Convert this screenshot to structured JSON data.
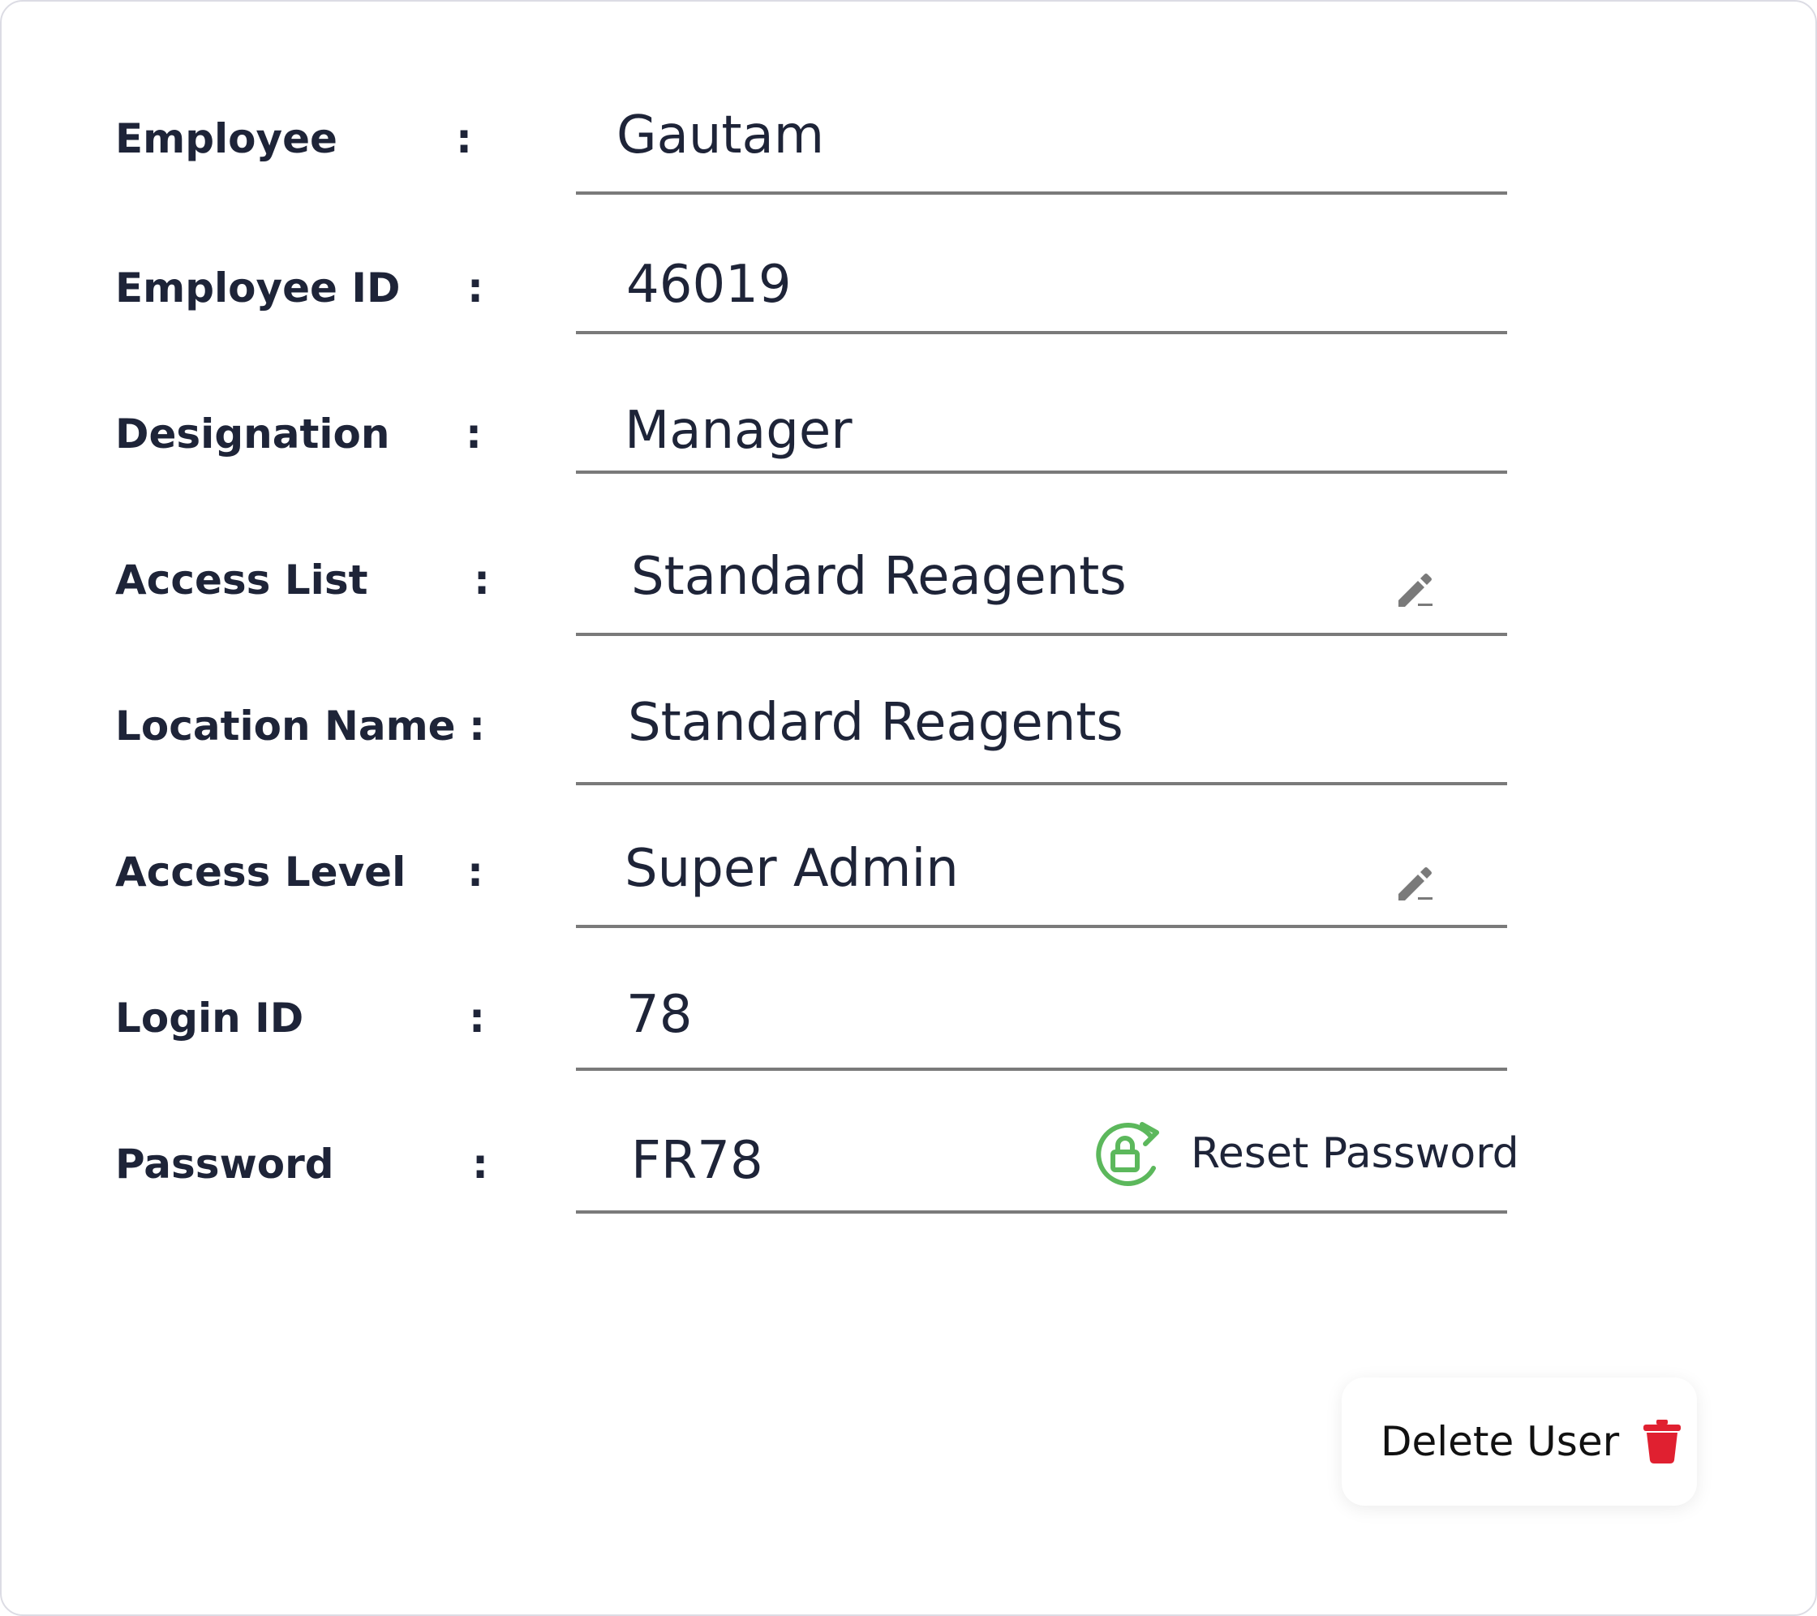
{
  "fields": [
    {
      "label": "Employee",
      "colon": ":",
      "value": "Gautam"
    },
    {
      "label": "Employee ID",
      "colon": ":",
      "value": "46019"
    },
    {
      "label": "Designation",
      "colon": ":",
      "value": "Manager"
    },
    {
      "label": "Access List",
      "colon": ":",
      "value": "Standard Reagents"
    },
    {
      "label": "Location Name",
      "colon": ":",
      "value": "Standard Reagents"
    },
    {
      "label": "Access Level",
      "colon": ":",
      "value": "Super Admin"
    },
    {
      "label": "Login ID",
      "colon": ":",
      "value": "78"
    },
    {
      "label": "Password",
      "colon": ":",
      "value": "FR78"
    }
  ],
  "reset_password": {
    "label": "Reset Password",
    "icon": "lock-refresh-icon",
    "color": "#5cb85c"
  },
  "delete_user": {
    "label": "Delete User",
    "icon": "trash-icon",
    "color": "#e02030"
  },
  "edit_icon": "pencil-icon",
  "colors": {
    "text": "#1e2438",
    "underline": "#7a7a7a",
    "border": "#dcdce4"
  }
}
